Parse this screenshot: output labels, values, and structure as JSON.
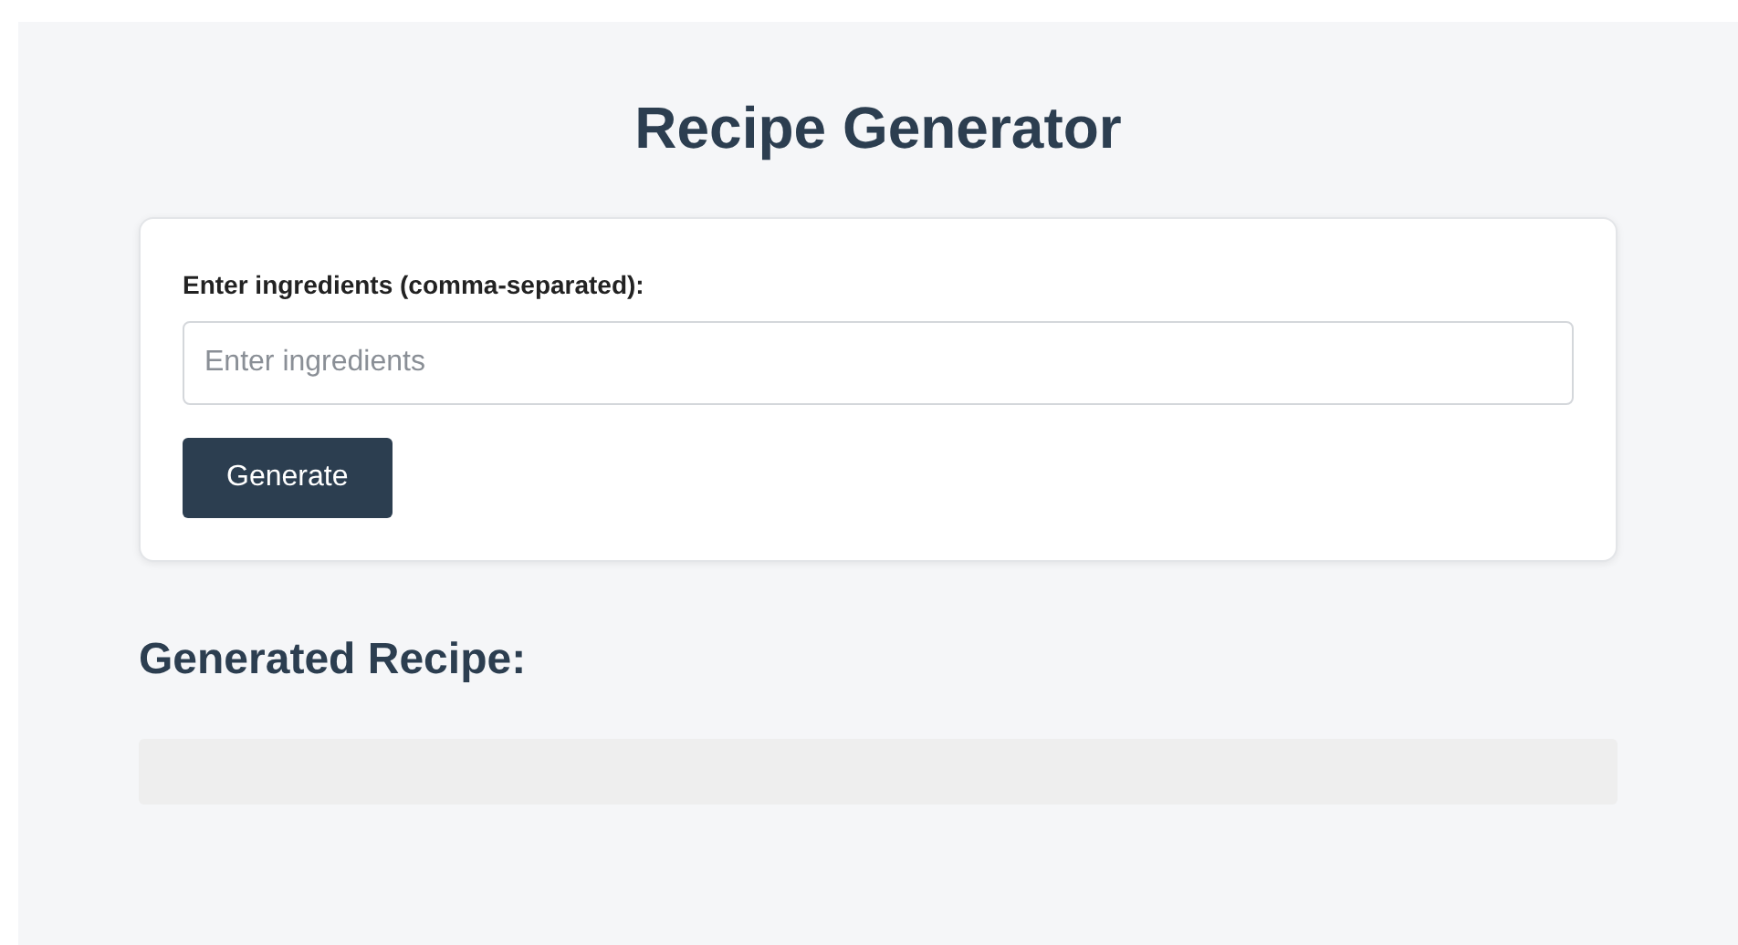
{
  "title": "Recipe Generator",
  "form": {
    "label": "Enter ingredients (comma-separated):",
    "input": {
      "placeholder": "Enter ingredients"
    },
    "button": "Generate"
  },
  "output": {
    "heading": "Generated Recipe:"
  }
}
